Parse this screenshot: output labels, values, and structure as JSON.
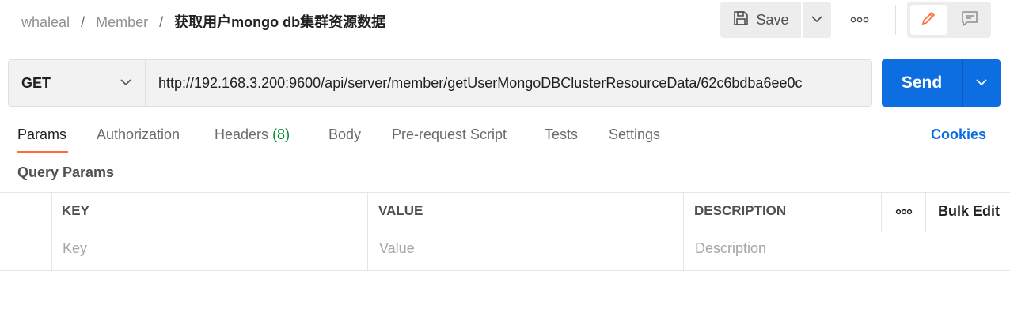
{
  "breadcrumb": {
    "workspace": "whaleal",
    "collection": "Member",
    "separator": "/",
    "request": "获取用户mongo db集群资源数据"
  },
  "toolbar": {
    "save_label": "Save",
    "save_icon": "save-icon",
    "more_icon": "more-horizontal-icon",
    "edit_icon": "pencil-icon",
    "comment_icon": "comment-icon"
  },
  "request": {
    "method": "GET",
    "url": "http://192.168.3.200:9600/api/server/member/getUserMongoDBClusterResourceData/62c6bdba6ee0c",
    "send_label": "Send"
  },
  "tabs": [
    {
      "label": "Params"
    },
    {
      "label": "Authorization"
    },
    {
      "label": "Headers",
      "count": "(8)"
    },
    {
      "label": "Body"
    },
    {
      "label": "Pre-request Script"
    },
    {
      "label": "Tests"
    },
    {
      "label": "Settings"
    }
  ],
  "cookies_label": "Cookies",
  "query_params": {
    "title": "Query Params",
    "columns": [
      "KEY",
      "VALUE",
      "DESCRIPTION"
    ],
    "bulk_edit_label": "Bulk Edit",
    "placeholders": {
      "key": "Key",
      "value": "Value",
      "description": "Description"
    }
  },
  "colors": {
    "accent_orange": "#ff6c37",
    "send_blue": "#0c6ee0",
    "count_green": "#0b8a3a"
  }
}
